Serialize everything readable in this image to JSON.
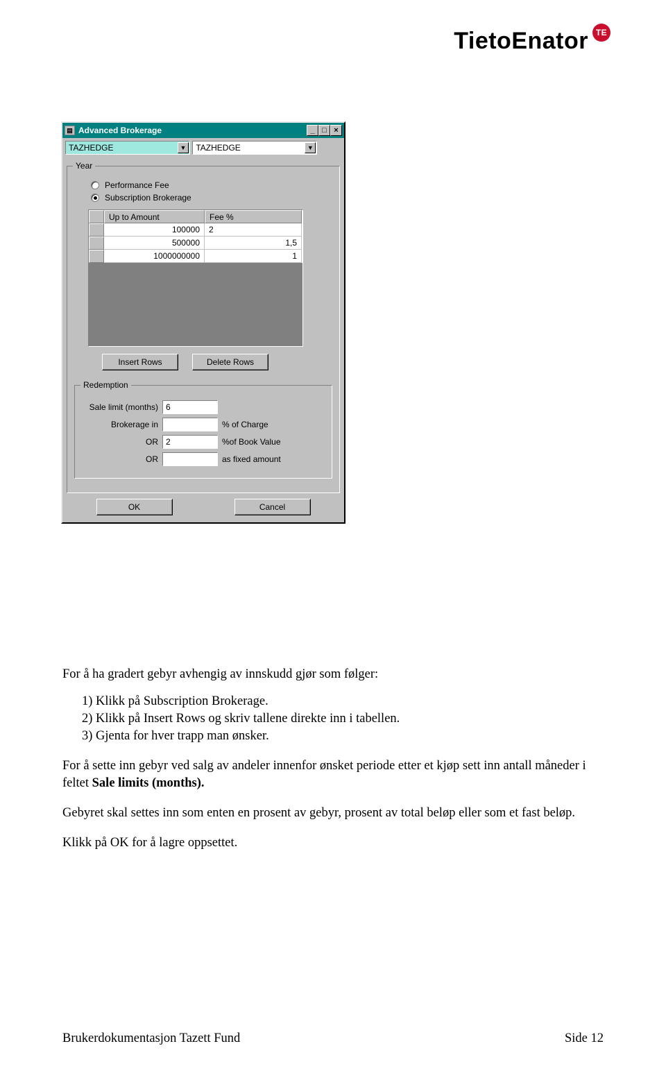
{
  "logo": {
    "text": "TietoEnator",
    "badge": "TE"
  },
  "win": {
    "title": "Advanced Brokerage",
    "btn_min": "_",
    "btn_max": "□",
    "btn_close": "×",
    "combo1": "TAZHEDGE",
    "combo2": "TAZHEDGE",
    "dd": "▼",
    "year_legend": "Year",
    "radio_perf": "Performance Fee",
    "radio_sub": "Subscription Brokerage",
    "grid": {
      "h_amt": "Up to Amount",
      "h_fee": "Fee %",
      "rows": [
        {
          "amt": "100000",
          "fee": "2"
        },
        {
          "amt": "500000",
          "fee": "1,5"
        },
        {
          "amt": "1000000000",
          "fee": "1"
        }
      ]
    },
    "btn_insert": "Insert Rows",
    "btn_delete": "Delete Rows",
    "redemption_legend": "Redemption",
    "sale_limit_label": "Sale limit (months)",
    "sale_limit_value": "6",
    "brokerage_label": "Brokerage in",
    "brokerage_suffix": "% of Charge",
    "or_label": "OR",
    "or1_value": "2",
    "or1_suffix": "%of Book Value",
    "or2_value": "",
    "or2_suffix": "as fixed amount",
    "btn_ok": "OK",
    "btn_cancel": "Cancel"
  },
  "doc": {
    "lead": "For å ha gradert gebyr avhengig av innskudd gjør som følger:",
    "n1": "1)  Klikk på Subscription Brokerage.",
    "n2": "2)  Klikk på Insert Rows og skriv tallene direkte inn i tabellen.",
    "n3": "3)  Gjenta for hver trapp man ønsker.",
    "p2a": "For å sette inn gebyr ved salg av andeler innenfor ønsket periode etter et kjøp sett inn antall måneder i feltet ",
    "p2b": "Sale limits (months).",
    "p3": "Gebyret skal settes inn som enten en prosent av gebyr, prosent av total beløp eller som et fast beløp.",
    "p4": "Klikk på OK for å lagre oppsettet."
  },
  "footer": {
    "left": "Brukerdokumentasjon Tazett Fund",
    "right": "Side 12"
  }
}
